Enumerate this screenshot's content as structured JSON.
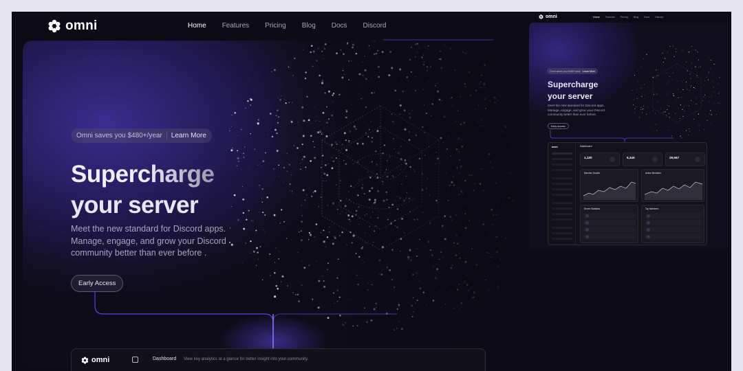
{
  "brand": {
    "name": "omni"
  },
  "nav": {
    "items": [
      "Home",
      "Features",
      "Pricing",
      "Blog",
      "Docs",
      "Discord"
    ],
    "active": "Home"
  },
  "hero": {
    "badge_text": "Omni saves you $480+/year",
    "badge_link": "Learn More",
    "title_line1": "Supercharge",
    "title_line2": "your server",
    "subtitle": "Meet the new standard for Discord apps. Manage, engage, and grow your Discord community better than ever before .",
    "cta_label": "Early Access"
  },
  "dashboard": {
    "brand": "omni",
    "title": "Dashboard",
    "description": "View key analytics at a glance for better insight into your community."
  },
  "preview": {
    "brand": "omni",
    "nav": [
      "Home",
      "Features",
      "Pricing",
      "Blog",
      "Docs",
      "Discord"
    ],
    "badge_text": "Omni saves you $480+/year",
    "badge_link": "Learn More",
    "title_line1": "Supercharge",
    "title_line2": "your server",
    "subtitle": "Meet the new standard for Discord apps. Manage, engage, and grow your Discord community better than ever before.",
    "cta_label": "Early Access",
    "dashboard": {
      "title": "Dashboard",
      "stats": [
        {
          "value": "1,120"
        },
        {
          "value": "6,340"
        },
        {
          "value": "29,567"
        }
      ],
      "cards": [
        "Member Growth",
        "Active Members",
        "Server Statistics",
        "Top Members"
      ]
    }
  },
  "colors": {
    "background": "#0c0a14",
    "accent": "#5b45e0",
    "hero_gradient": "#3a2c8f",
    "page_outer": "#e7e4f1"
  }
}
